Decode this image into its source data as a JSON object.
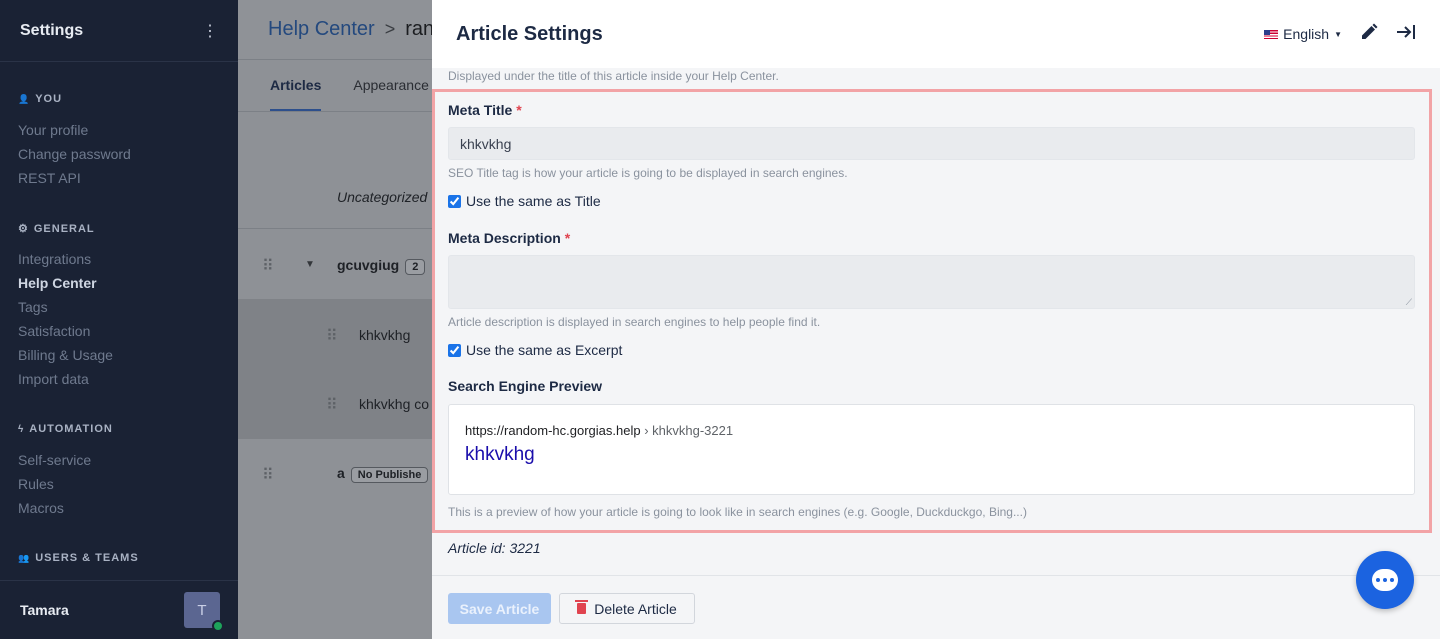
{
  "sidebar": {
    "title": "Settings",
    "menu_glyph": "⋮",
    "sections": [
      {
        "label": "YOU",
        "icon": "user-icon",
        "glyph": "👤"
      },
      {
        "label": "GENERAL",
        "icon": "gear-icon",
        "glyph": "⚙"
      },
      {
        "label": "AUTOMATION",
        "icon": "bolt-icon",
        "glyph": "ϟ"
      },
      {
        "label": "USERS & TEAMS",
        "icon": "users-icon",
        "glyph": "👥"
      }
    ],
    "items": [
      "Your profile",
      "Change password",
      "REST API",
      "Integrations",
      "Help Center",
      "Tags",
      "Satisfaction",
      "Billing & Usage",
      "Import data",
      "Self-service",
      "Rules",
      "Macros"
    ],
    "active_item": "Help Center",
    "user": {
      "name": "Tamara",
      "initial": "T",
      "status_color": "#1ea35b"
    }
  },
  "main": {
    "breadcrumb": [
      "Help Center",
      "ran"
    ],
    "breadcrumb_sep": ">",
    "tabs": [
      "Articles",
      "Appearance"
    ],
    "active_tab": "Articles",
    "rows": [
      {
        "text": "Uncategorized"
      },
      {
        "text": "gcuvgiug",
        "badge": "2"
      },
      {
        "text": "khkvkhg"
      },
      {
        "text": "khkvkhg co"
      },
      {
        "text": "a",
        "badge": "No Publishe"
      }
    ]
  },
  "drawer": {
    "title": "Article Settings",
    "language": "English",
    "excerpt_help": "Displayed under the title of this article inside your Help Center.",
    "meta_title": {
      "label": "Meta Title",
      "required_mark": "*",
      "value": "khkvkhg",
      "help": "SEO Title tag is how your article is going to be displayed in search engines.",
      "checkbox_label": "Use the same as Title",
      "checked": true
    },
    "meta_description": {
      "label": "Meta Description",
      "required_mark": "*",
      "value": "",
      "help": "Article description is displayed in search engines to help people find it.",
      "checkbox_label": "Use the same as Excerpt",
      "checked": true
    },
    "preview": {
      "label": "Search Engine Preview",
      "url_base": "https://random-hc.gorgias.help",
      "url_path": " › khkvkhg-3221",
      "title": "khkvkhg",
      "help": "This is a preview of how your article is going to look like in search engines (e.g. Google, Duckduckgo, Bing...)"
    },
    "article_id": "Article id: 3221",
    "save_label": "Save Article",
    "delete_label": "Delete Article",
    "highlight_color": "#f2a3a6"
  }
}
